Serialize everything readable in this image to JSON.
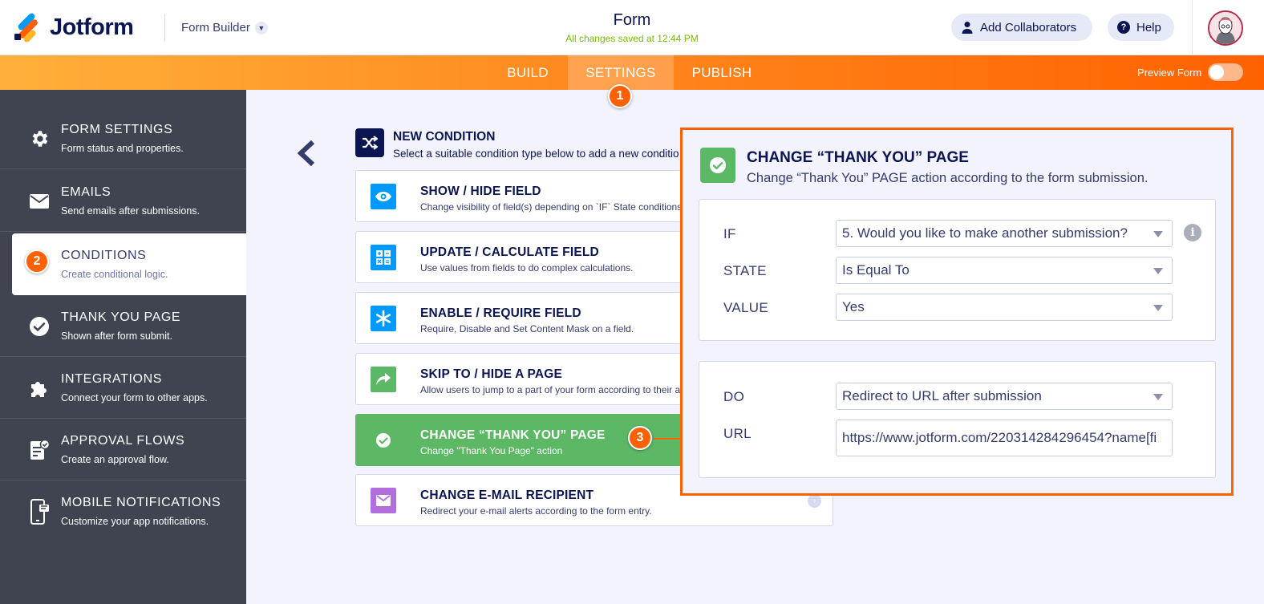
{
  "header": {
    "logo_text": "Jotform",
    "builder_menu": "Form Builder",
    "form_title": "Form",
    "save_status": "All changes saved at 12:44 PM",
    "add_collaborators": "Add Collaborators",
    "help": "Help"
  },
  "tabs": {
    "build": "BUILD",
    "settings": "SETTINGS",
    "publish": "PUBLISH",
    "active": "settings",
    "preview_label": "Preview Form",
    "preview_on": false
  },
  "steps": {
    "one": "1",
    "two": "2",
    "three": "3"
  },
  "sidebar": {
    "items": [
      {
        "title": "FORM SETTINGS",
        "sub": "Form status and properties.",
        "icon": "gear-icon"
      },
      {
        "title": "EMAILS",
        "sub": "Send emails after submissions.",
        "icon": "envelope-icon"
      },
      {
        "title": "CONDITIONS",
        "sub": "Create conditional logic.",
        "icon": "conditions-icon",
        "active": true
      },
      {
        "title": "THANK YOU PAGE",
        "sub": "Shown after form submit.",
        "icon": "check-circle-icon"
      },
      {
        "title": "INTEGRATIONS",
        "sub": "Connect your form to other apps.",
        "icon": "puzzle-icon"
      },
      {
        "title": "APPROVAL FLOWS",
        "sub": "Create an approval flow.",
        "icon": "approval-icon"
      },
      {
        "title": "MOBILE NOTIFICATIONS",
        "sub": "Customize your app notifications.",
        "icon": "mobile-icon"
      }
    ]
  },
  "new_condition": {
    "title": "NEW CONDITION",
    "subtitle": "Select a suitable condition type below to add a new conditio"
  },
  "conditions": [
    {
      "title": "SHOW / HIDE FIELD",
      "sub": "Change visibility of field(s) depending on `IF` State conditions.",
      "icon": "eye-icon",
      "color": "#0099ff"
    },
    {
      "title": "UPDATE / CALCULATE FIELD",
      "sub": "Use values from fields to do complex calculations.",
      "icon": "calculator-icon",
      "color": "#0099ff"
    },
    {
      "title": "ENABLE / REQUIRE FIELD",
      "sub": "Require, Disable and Set Content Mask on a field.",
      "icon": "asterisk-icon",
      "color": "#0099ff"
    },
    {
      "title": "SKIP TO / HIDE A PAGE",
      "sub": "Allow users to jump to a part of your form according to their a",
      "icon": "share-arrow-icon",
      "color": "#5cb865"
    },
    {
      "title": "CHANGE “THANK YOU” PAGE",
      "sub": "Change \"Thank You Page\" action",
      "icon": "check-circle-icon",
      "color": "#5cb865",
      "selected": true
    },
    {
      "title": "CHANGE E-MAIL RECIPIENT",
      "sub": "Redirect your e-mail alerts according to the form entry.",
      "icon": "envelope-icon",
      "color": "#b26fdc"
    }
  ],
  "panel": {
    "title": "CHANGE “THANK YOU” PAGE",
    "subtitle": "Change “Thank You” PAGE action according to the form submission.",
    "if_label": "IF",
    "if_value": "5. Would you like to make another submission?",
    "state_label": "STATE",
    "state_value": "Is Equal To",
    "value_label": "VALUE",
    "value_value": "Yes",
    "do_label": "DO",
    "do_value": "Redirect to URL after submission",
    "url_label": "URL",
    "url_value": "https://www.jotform.com/220314284296454?name[fi"
  }
}
